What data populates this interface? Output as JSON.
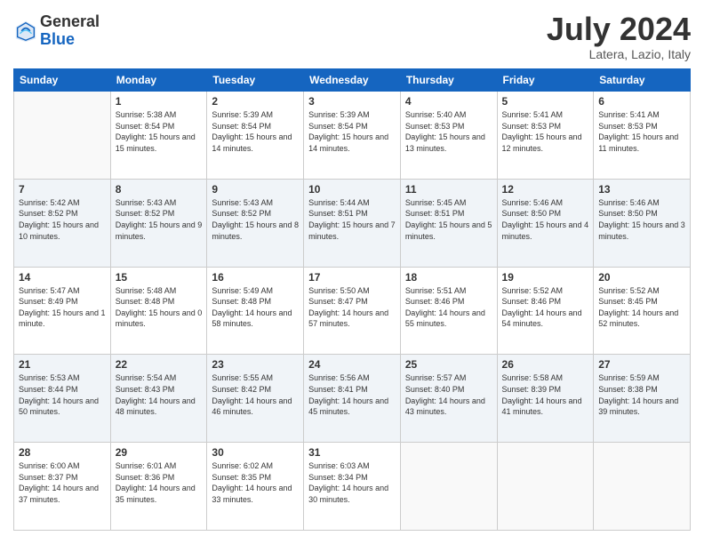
{
  "logo": {
    "general": "General",
    "blue": "Blue"
  },
  "title": {
    "month": "July 2024",
    "location": "Latera, Lazio, Italy"
  },
  "days_of_week": [
    "Sunday",
    "Monday",
    "Tuesday",
    "Wednesday",
    "Thursday",
    "Friday",
    "Saturday"
  ],
  "weeks": [
    [
      {
        "day": "",
        "sunrise": "",
        "sunset": "",
        "daylight": ""
      },
      {
        "day": "1",
        "sunrise": "Sunrise: 5:38 AM",
        "sunset": "Sunset: 8:54 PM",
        "daylight": "Daylight: 15 hours and 15 minutes."
      },
      {
        "day": "2",
        "sunrise": "Sunrise: 5:39 AM",
        "sunset": "Sunset: 8:54 PM",
        "daylight": "Daylight: 15 hours and 14 minutes."
      },
      {
        "day": "3",
        "sunrise": "Sunrise: 5:39 AM",
        "sunset": "Sunset: 8:54 PM",
        "daylight": "Daylight: 15 hours and 14 minutes."
      },
      {
        "day": "4",
        "sunrise": "Sunrise: 5:40 AM",
        "sunset": "Sunset: 8:53 PM",
        "daylight": "Daylight: 15 hours and 13 minutes."
      },
      {
        "day": "5",
        "sunrise": "Sunrise: 5:41 AM",
        "sunset": "Sunset: 8:53 PM",
        "daylight": "Daylight: 15 hours and 12 minutes."
      },
      {
        "day": "6",
        "sunrise": "Sunrise: 5:41 AM",
        "sunset": "Sunset: 8:53 PM",
        "daylight": "Daylight: 15 hours and 11 minutes."
      }
    ],
    [
      {
        "day": "7",
        "sunrise": "Sunrise: 5:42 AM",
        "sunset": "Sunset: 8:52 PM",
        "daylight": "Daylight: 15 hours and 10 minutes."
      },
      {
        "day": "8",
        "sunrise": "Sunrise: 5:43 AM",
        "sunset": "Sunset: 8:52 PM",
        "daylight": "Daylight: 15 hours and 9 minutes."
      },
      {
        "day": "9",
        "sunrise": "Sunrise: 5:43 AM",
        "sunset": "Sunset: 8:52 PM",
        "daylight": "Daylight: 15 hours and 8 minutes."
      },
      {
        "day": "10",
        "sunrise": "Sunrise: 5:44 AM",
        "sunset": "Sunset: 8:51 PM",
        "daylight": "Daylight: 15 hours and 7 minutes."
      },
      {
        "day": "11",
        "sunrise": "Sunrise: 5:45 AM",
        "sunset": "Sunset: 8:51 PM",
        "daylight": "Daylight: 15 hours and 5 minutes."
      },
      {
        "day": "12",
        "sunrise": "Sunrise: 5:46 AM",
        "sunset": "Sunset: 8:50 PM",
        "daylight": "Daylight: 15 hours and 4 minutes."
      },
      {
        "day": "13",
        "sunrise": "Sunrise: 5:46 AM",
        "sunset": "Sunset: 8:50 PM",
        "daylight": "Daylight: 15 hours and 3 minutes."
      }
    ],
    [
      {
        "day": "14",
        "sunrise": "Sunrise: 5:47 AM",
        "sunset": "Sunset: 8:49 PM",
        "daylight": "Daylight: 15 hours and 1 minute."
      },
      {
        "day": "15",
        "sunrise": "Sunrise: 5:48 AM",
        "sunset": "Sunset: 8:48 PM",
        "daylight": "Daylight: 15 hours and 0 minutes."
      },
      {
        "day": "16",
        "sunrise": "Sunrise: 5:49 AM",
        "sunset": "Sunset: 8:48 PM",
        "daylight": "Daylight: 14 hours and 58 minutes."
      },
      {
        "day": "17",
        "sunrise": "Sunrise: 5:50 AM",
        "sunset": "Sunset: 8:47 PM",
        "daylight": "Daylight: 14 hours and 57 minutes."
      },
      {
        "day": "18",
        "sunrise": "Sunrise: 5:51 AM",
        "sunset": "Sunset: 8:46 PM",
        "daylight": "Daylight: 14 hours and 55 minutes."
      },
      {
        "day": "19",
        "sunrise": "Sunrise: 5:52 AM",
        "sunset": "Sunset: 8:46 PM",
        "daylight": "Daylight: 14 hours and 54 minutes."
      },
      {
        "day": "20",
        "sunrise": "Sunrise: 5:52 AM",
        "sunset": "Sunset: 8:45 PM",
        "daylight": "Daylight: 14 hours and 52 minutes."
      }
    ],
    [
      {
        "day": "21",
        "sunrise": "Sunrise: 5:53 AM",
        "sunset": "Sunset: 8:44 PM",
        "daylight": "Daylight: 14 hours and 50 minutes."
      },
      {
        "day": "22",
        "sunrise": "Sunrise: 5:54 AM",
        "sunset": "Sunset: 8:43 PM",
        "daylight": "Daylight: 14 hours and 48 minutes."
      },
      {
        "day": "23",
        "sunrise": "Sunrise: 5:55 AM",
        "sunset": "Sunset: 8:42 PM",
        "daylight": "Daylight: 14 hours and 46 minutes."
      },
      {
        "day": "24",
        "sunrise": "Sunrise: 5:56 AM",
        "sunset": "Sunset: 8:41 PM",
        "daylight": "Daylight: 14 hours and 45 minutes."
      },
      {
        "day": "25",
        "sunrise": "Sunrise: 5:57 AM",
        "sunset": "Sunset: 8:40 PM",
        "daylight": "Daylight: 14 hours and 43 minutes."
      },
      {
        "day": "26",
        "sunrise": "Sunrise: 5:58 AM",
        "sunset": "Sunset: 8:39 PM",
        "daylight": "Daylight: 14 hours and 41 minutes."
      },
      {
        "day": "27",
        "sunrise": "Sunrise: 5:59 AM",
        "sunset": "Sunset: 8:38 PM",
        "daylight": "Daylight: 14 hours and 39 minutes."
      }
    ],
    [
      {
        "day": "28",
        "sunrise": "Sunrise: 6:00 AM",
        "sunset": "Sunset: 8:37 PM",
        "daylight": "Daylight: 14 hours and 37 minutes."
      },
      {
        "day": "29",
        "sunrise": "Sunrise: 6:01 AM",
        "sunset": "Sunset: 8:36 PM",
        "daylight": "Daylight: 14 hours and 35 minutes."
      },
      {
        "day": "30",
        "sunrise": "Sunrise: 6:02 AM",
        "sunset": "Sunset: 8:35 PM",
        "daylight": "Daylight: 14 hours and 33 minutes."
      },
      {
        "day": "31",
        "sunrise": "Sunrise: 6:03 AM",
        "sunset": "Sunset: 8:34 PM",
        "daylight": "Daylight: 14 hours and 30 minutes."
      },
      {
        "day": "",
        "sunrise": "",
        "sunset": "",
        "daylight": ""
      },
      {
        "day": "",
        "sunrise": "",
        "sunset": "",
        "daylight": ""
      },
      {
        "day": "",
        "sunrise": "",
        "sunset": "",
        "daylight": ""
      }
    ]
  ]
}
